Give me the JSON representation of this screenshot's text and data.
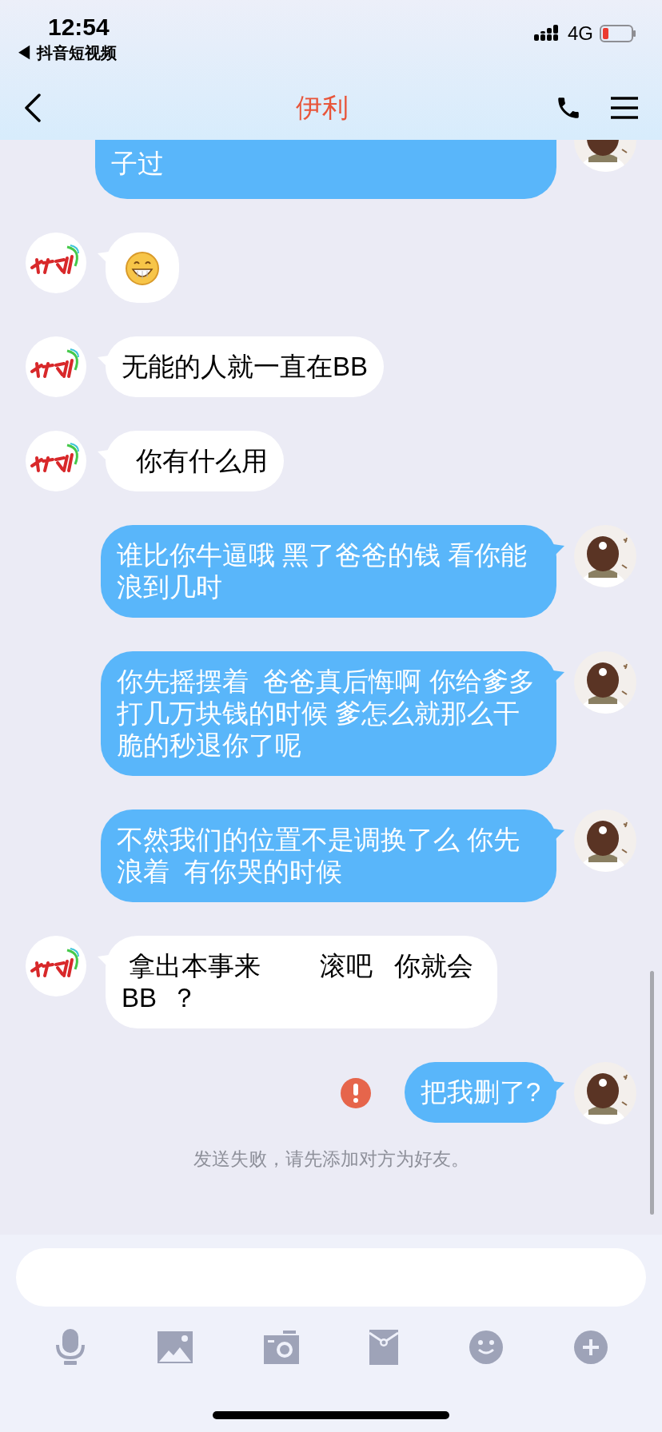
{
  "status_bar": {
    "time": "12:54",
    "back_app": "◀ 抖音短视频",
    "network": "4G"
  },
  "header": {
    "title": "伊利"
  },
  "messages": [
    {
      "outgoing": true,
      "kind": "text",
      "text": "子过",
      "failed": false
    },
    {
      "outgoing": false,
      "kind": "emoji",
      "failed": false
    },
    {
      "outgoing": false,
      "kind": "text",
      "text": "无能的人就一直在BB",
      "failed": false
    },
    {
      "outgoing": false,
      "kind": "text",
      "text": "  你有什么用",
      "failed": false
    },
    {
      "outgoing": true,
      "kind": "text",
      "text": "谁比你牛逼哦 黑了爸爸的钱 看你能浪到几时",
      "failed": false
    },
    {
      "outgoing": true,
      "kind": "text",
      "text": "你先摇摆着  爸爸真后悔啊 你给爹多打几万块钱的时候 爹怎么就那么干脆的秒退你了呢",
      "failed": false
    },
    {
      "outgoing": true,
      "kind": "text",
      "text": "不然我们的位置不是调换了么 你先浪着  有你哭的时候",
      "failed": false
    },
    {
      "outgoing": false,
      "kind": "text",
      "text": " 拿出本事来        滚吧   你就会BB  ？",
      "failed": false
    },
    {
      "outgoing": true,
      "kind": "text",
      "text": "把我删了?",
      "failed": true
    }
  ],
  "notice": "发送失败，请先添加对方为好友。"
}
